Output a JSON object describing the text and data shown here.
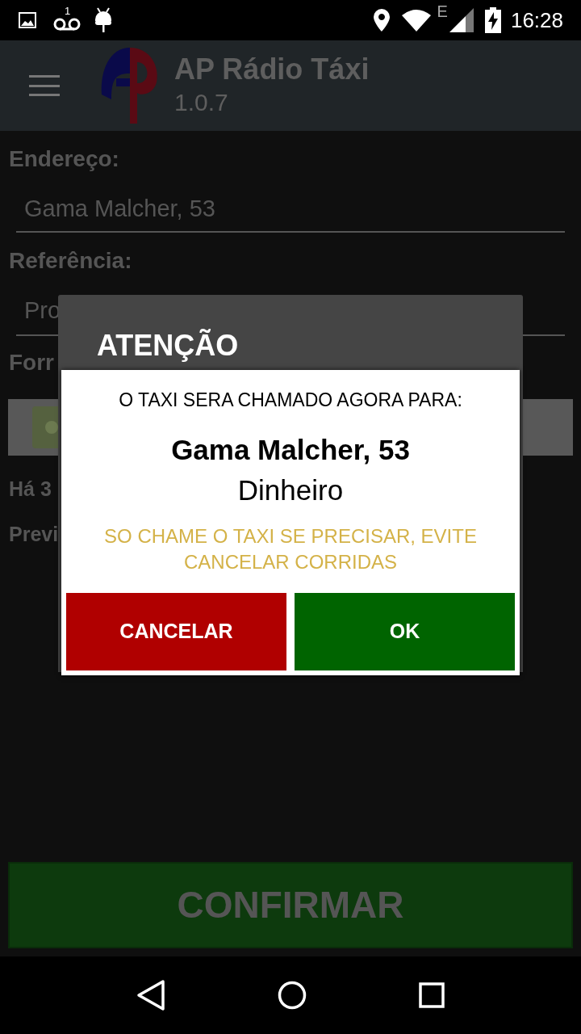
{
  "status_bar": {
    "time": "16:28",
    "voicemail_count": "1",
    "network_type": "E"
  },
  "app_bar": {
    "title": "AP Rádio Táxi",
    "version": "1.0.7"
  },
  "form": {
    "address_label": "Endereço:",
    "address_value": "Gama Malcher, 53",
    "reference_label": "Referência:",
    "reference_value": "Pro",
    "payment_label": "Forr",
    "info_line": "Há 3",
    "estimate_line": "Previ"
  },
  "dialog": {
    "title": "ATENÇÃO",
    "intro": "O TAXI SERA CHAMADO AGORA PARA:",
    "address": "Gama Malcher, 53",
    "payment": "Dinheiro",
    "warning": "SO CHAME O TAXI SE PRECISAR, EVITE CANCELAR CORRIDAS",
    "buttons": [
      {
        "label": "CANCELAR",
        "kind": "cancel"
      },
      {
        "label": "OK",
        "kind": "ok"
      }
    ]
  },
  "confirm_button": "CONFIRMAR"
}
